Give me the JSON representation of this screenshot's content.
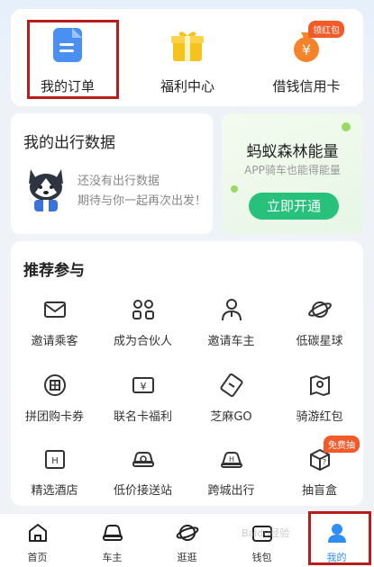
{
  "top": {
    "items": [
      {
        "label": "我的订单",
        "icon": "document-icon"
      },
      {
        "label": "福利中心",
        "icon": "gift-icon"
      },
      {
        "label": "借钱信用卡",
        "icon": "money-bag-icon",
        "badge": "领红包"
      }
    ]
  },
  "trip": {
    "title": "我的出行数据",
    "line1": "还没有出行数据",
    "line2": "期待与你一起再次出发！"
  },
  "forest": {
    "title": "蚂蚁森林能量",
    "subtitle": "APP骑车也能得能量",
    "button": "立即开通"
  },
  "recommend": {
    "title": "推荐参与",
    "items": [
      {
        "label": "邀请乘客",
        "icon": "envelope-icon"
      },
      {
        "label": "成为合伙人",
        "icon": "partner-icon"
      },
      {
        "label": "邀请车主",
        "icon": "driver-icon"
      },
      {
        "label": "低碳星球",
        "icon": "planet-icon"
      },
      {
        "label": "拼团购卡券",
        "icon": "group-icon"
      },
      {
        "label": "联名卡福利",
        "icon": "card-icon"
      },
      {
        "label": "芝麻GO",
        "icon": "ticket-icon"
      },
      {
        "label": "骑游红包",
        "icon": "map-icon"
      },
      {
        "label": "精选酒店",
        "icon": "hotel-icon"
      },
      {
        "label": "低价接送站",
        "icon": "car-icon"
      },
      {
        "label": "跨城出行",
        "icon": "intercity-icon"
      },
      {
        "label": "抽盲盒",
        "icon": "blind-box-icon",
        "badge": "免费抽"
      }
    ]
  },
  "nav": {
    "items": [
      {
        "label": "首页",
        "icon": "home-icon"
      },
      {
        "label": "车主",
        "icon": "car-owner-icon"
      },
      {
        "label": "逛逛",
        "icon": "planet-nav-icon"
      },
      {
        "label": "钱包",
        "icon": "wallet-icon"
      },
      {
        "label": "我的",
        "icon": "profile-icon"
      }
    ]
  },
  "watermark": "Baidu经验",
  "colors": {
    "accent": "#27c17b",
    "highlight": "#b81c1c",
    "badge": "#f25a2a",
    "active": "#2f8ef5"
  }
}
